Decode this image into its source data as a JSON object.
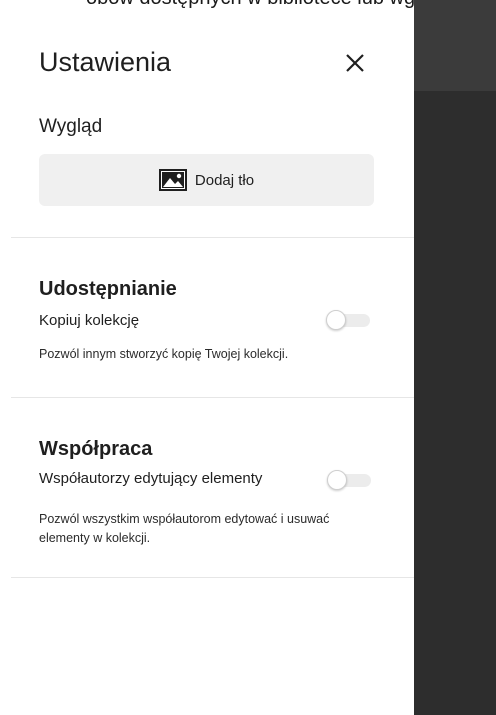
{
  "background_text": "obów dostępnych w bibliotece lub wgr",
  "panel": {
    "title": "Ustawienia",
    "close_icon": "close-icon"
  },
  "appearance": {
    "heading": "Wygląd",
    "add_background_label": "Dodaj tło",
    "add_background_icon": "image-icon"
  },
  "sharing": {
    "heading": "Udostępnianie",
    "copy_label": "Kopiuj kolekcję",
    "copy_enabled": false,
    "copy_description": "Pozwól innym stworzyć kopię Twojej kolekcji."
  },
  "collaboration": {
    "heading": "Współpraca",
    "coauthors_label": "Współautorzy edytujący elementy",
    "coauthors_enabled": false,
    "coauthors_description": "Pozwól wszystkim współautorom edytować i usuwać elementy w kolekcji."
  },
  "colors": {
    "panel_bg": "#ffffff",
    "overlay_bg": "#2d2d2d",
    "button_bg": "#f0f0f0"
  }
}
